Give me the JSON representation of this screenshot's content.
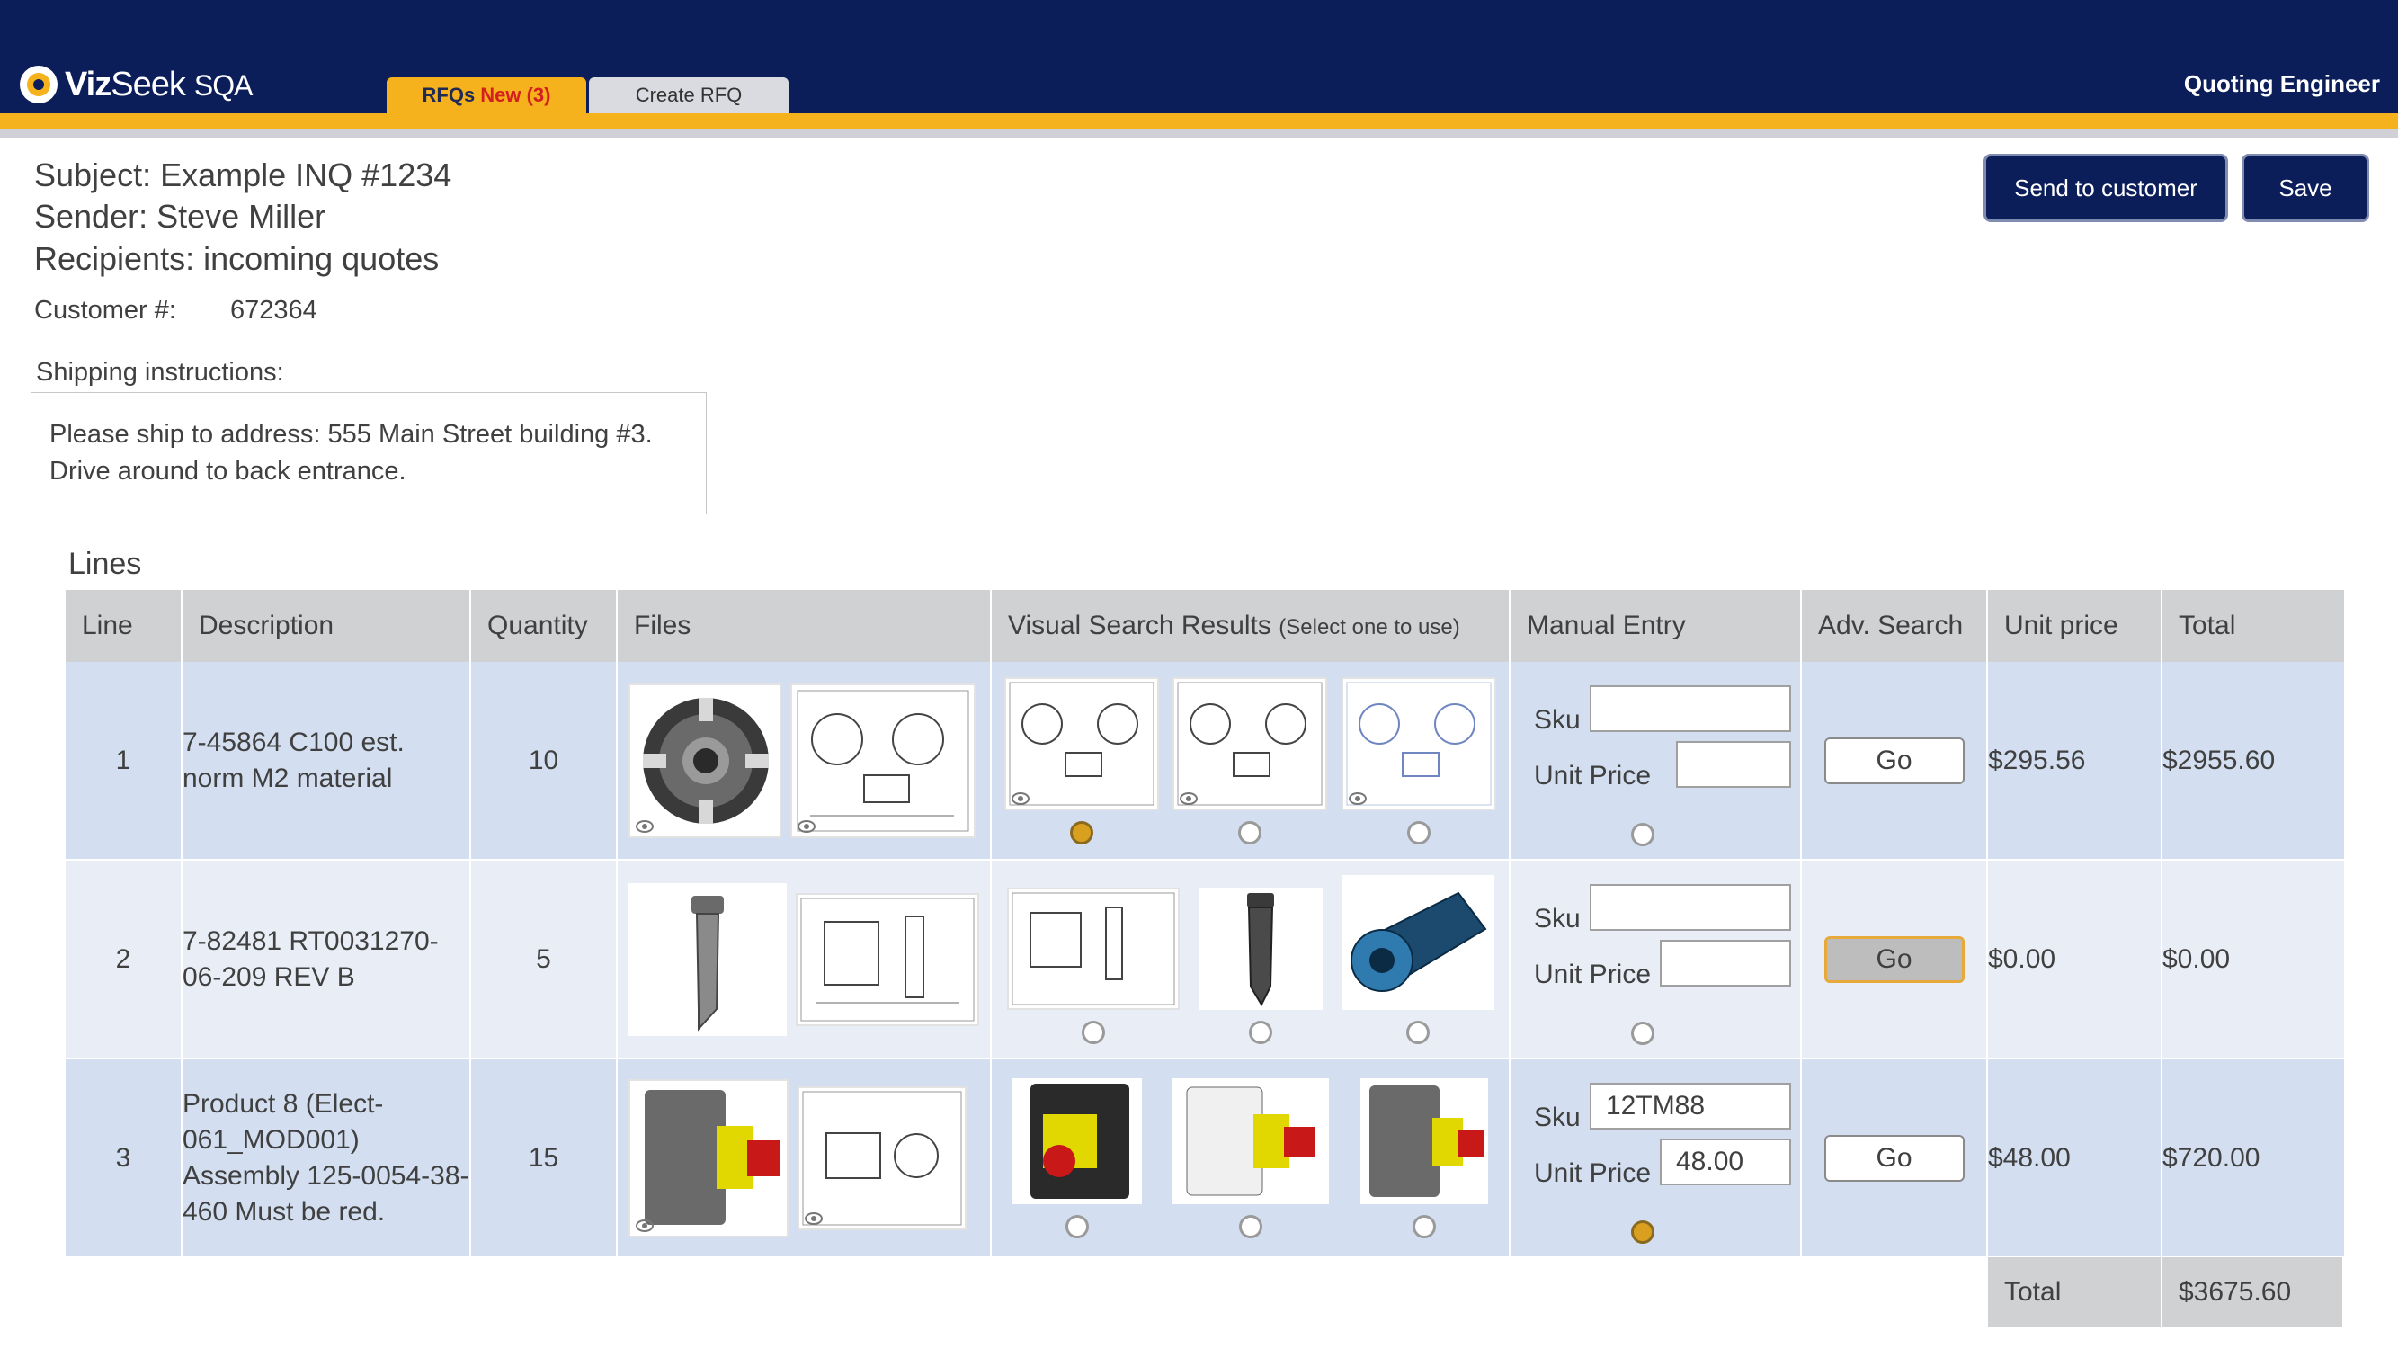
{
  "header": {
    "logo_bold": "Viz",
    "logo_thin": "Seek",
    "logo_product": "SQA",
    "tabs": [
      {
        "label": "RFQs",
        "badge": "New (3)"
      },
      {
        "label": "Create RFQ"
      }
    ],
    "role": "Quoting Engineer"
  },
  "actions": {
    "send_label": "Send to customer",
    "save_label": "Save"
  },
  "inquiry": {
    "subject": "Subject: Example INQ #1234",
    "sender": "Sender: Steve Miller",
    "recipients": "Recipients: incoming quotes",
    "customer_label": "Customer #:",
    "customer_value": "672364",
    "shipping_label": "Shipping instructions:",
    "shipping_text": "Please ship to address: 555 Main Street building #3. Drive around to back entrance."
  },
  "lines_section": {
    "title": "Lines",
    "columns": [
      "Line",
      "Description",
      "Quantity",
      "Files",
      "Visual Search Results",
      "(Select one to use)",
      "Manual Entry",
      "Adv. Search",
      "Unit price",
      "Total"
    ],
    "sku_label": "Sku",
    "unit_price_label": "Unit Price",
    "go_label": "Go",
    "rows": [
      {
        "line": "1",
        "description": "7-45864 C100 est. norm M2 material",
        "quantity": "10",
        "sku": "",
        "unit_price_input": "",
        "unit_price": "$295.56",
        "total": "$2955.60"
      },
      {
        "line": "2",
        "description": "7-82481 RT0031270-06-209 REV B",
        "quantity": "5",
        "sku": "",
        "unit_price_input": "",
        "unit_price": "$0.00",
        "total": "$0.00"
      },
      {
        "line": "3",
        "description": "Product 8 (Elect-061_MOD001) Assembly 125-0054-38-460 Must be red.",
        "quantity": "15",
        "sku": "12TM88",
        "unit_price_input": "48.00",
        "unit_price": "$48.00",
        "total": "$720.00"
      }
    ],
    "grand_total_label": "Total",
    "grand_total": "$3675.60"
  },
  "colors": {
    "header_navy": "#0b1e5a",
    "accent_gold": "#f5b21c",
    "badge_red": "#d41f1f",
    "row_blue": "#d3dff0"
  }
}
